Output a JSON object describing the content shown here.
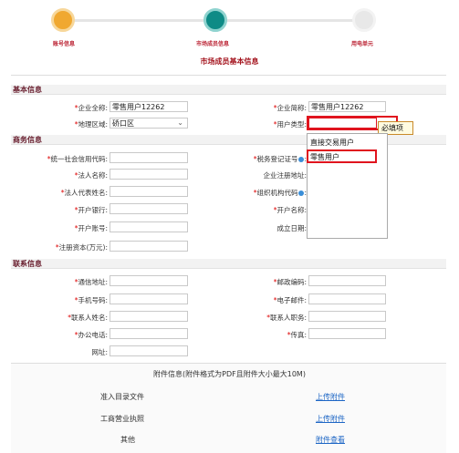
{
  "steps": [
    {
      "label": "账号信息"
    },
    {
      "label": "市场成员信息"
    },
    {
      "label": "用电单元"
    }
  ],
  "page_title": "市场成员基本信息",
  "colors": {
    "step_done": "#f0a830",
    "step_current": "#0e8b86",
    "step_todo": "#e8e8e8",
    "title": "#a4141e",
    "error_border": "#e0141e"
  },
  "basic": {
    "section": "基本信息",
    "company_full_name_label": "企业全称:",
    "company_full_name_value": "零售用户12262",
    "company_short_name_label": "企业简称:",
    "company_short_name_value": "零售用户12262",
    "region_label": "地理区域:",
    "region_value": "硚口区",
    "user_type_label": "用户类型:",
    "user_type_tip": "必填项",
    "user_type_options": [
      "直接交易用户",
      "零售用户"
    ]
  },
  "business": {
    "section": "商务信息",
    "credit_code_label": "统一社会信用代码:",
    "tax_reg_label": "税务登记证号",
    "legal_person_label": "法人名称:",
    "reg_address_label": "企业注册地址:",
    "legal_rep_label": "法人代表姓名:",
    "org_code_label": "组织机构代码",
    "bank_label": "开户银行:",
    "account_name_label": "开户名称:",
    "account_no_label": "开户账号:",
    "established_label": "成立日期:",
    "capital_label": "注册资本(万元):"
  },
  "contact": {
    "section": "联系信息",
    "address_label": "通信地址:",
    "postcode_label": "邮政编码:",
    "mobile_label": "手机号码:",
    "email_label": "电子邮件:",
    "contact_name_label": "联系人姓名:",
    "contact_title_label": "联系人职务:",
    "office_phone_label": "办公电话:",
    "fax_label": "传真:",
    "website_label": "网址:"
  },
  "attachments": {
    "header": "附件信息(附件格式为PDF且附件大小最大10M)",
    "items": [
      {
        "name": "准入目录文件",
        "action": "上传附件"
      },
      {
        "name": "工商营业执照",
        "action": "上传附件"
      },
      {
        "name": "其他",
        "action": "附件查看"
      }
    ]
  }
}
